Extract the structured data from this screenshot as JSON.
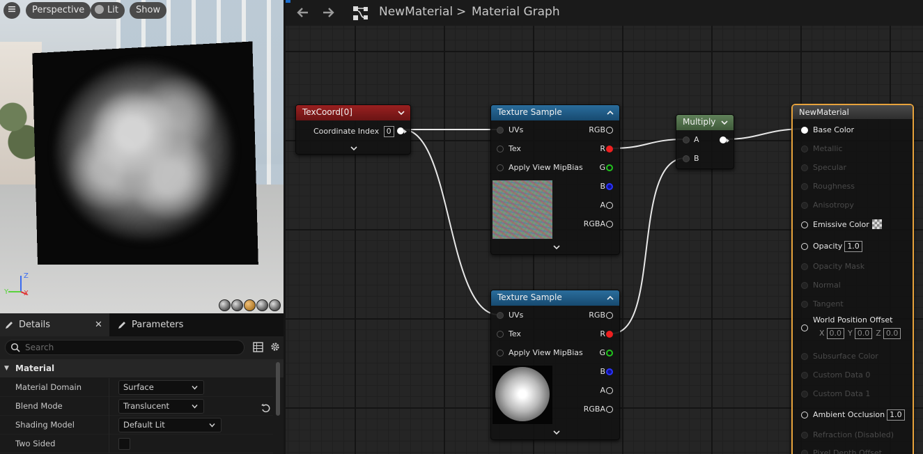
{
  "viewport": {
    "menu_icon": "hamburger-icon",
    "perspective_label": "Perspective",
    "lit_label": "Lit",
    "show_label": "Show",
    "axis": {
      "x": "X",
      "y": "Y",
      "z": "Z"
    }
  },
  "details": {
    "tabs": [
      {
        "label": "Details"
      },
      {
        "label": "Parameters"
      }
    ],
    "close_glyph": "✕",
    "search_placeholder": "Search",
    "category": "Material",
    "rows": [
      {
        "label": "Material Domain",
        "value": "Surface"
      },
      {
        "label": "Blend Mode",
        "value": "Translucent"
      },
      {
        "label": "Shading Model",
        "value": "Default Lit"
      },
      {
        "label": "Two Sided",
        "value": false
      }
    ]
  },
  "graph": {
    "breadcrumb": {
      "asset": "NewMaterial",
      "separator": ">",
      "graph": "Material Graph"
    },
    "texcoord": {
      "title": "TexCoord[0]",
      "pin_label": "Coordinate Index",
      "index_value": "0"
    },
    "texture_sample_1": {
      "title": "Texture Sample",
      "inputs": [
        "UVs",
        "Tex",
        "Apply View MipBias"
      ],
      "outputs": [
        "RGB",
        "R",
        "G",
        "B",
        "A",
        "RGBA"
      ]
    },
    "texture_sample_2": {
      "title": "Texture Sample",
      "inputs": [
        "UVs",
        "Tex",
        "Apply View MipBias"
      ],
      "outputs": [
        "RGB",
        "R",
        "G",
        "B",
        "A",
        "RGBA"
      ]
    },
    "multiply": {
      "title": "Multiply",
      "inputs": [
        "A",
        "B"
      ]
    },
    "result": {
      "title": "NewMaterial",
      "pins": [
        {
          "label": "Base Color",
          "active": true
        },
        {
          "label": "Metallic",
          "active": false
        },
        {
          "label": "Specular",
          "active": false
        },
        {
          "label": "Roughness",
          "active": false
        },
        {
          "label": "Anisotropy",
          "active": false
        },
        {
          "label": "Emissive Color",
          "active": true
        },
        {
          "label": "Opacity",
          "active": true,
          "value": "1.0"
        },
        {
          "label": "Opacity Mask",
          "active": false
        },
        {
          "label": "Normal",
          "active": false
        },
        {
          "label": "Tangent",
          "active": false
        },
        {
          "label": "World Position Offset",
          "active": true
        },
        {
          "label": "Subsurface Color",
          "active": false
        },
        {
          "label": "Custom Data 0",
          "active": false
        },
        {
          "label": "Custom Data 1",
          "active": false
        },
        {
          "label": "Ambient Occlusion",
          "active": true,
          "value": "1.0"
        },
        {
          "label": "Refraction (Disabled)",
          "active": false
        },
        {
          "label": "Pixel Depth Offset",
          "active": false
        }
      ],
      "wpo": {
        "x_label": "X",
        "x": "0.0",
        "y_label": "Y",
        "y": "0.0",
        "z_label": "Z",
        "z": "0.0"
      }
    }
  },
  "colors": {
    "texcoord_header": "#8a1a1a",
    "texture_header": "#1c5a86",
    "multiply_header": "#4f6e48",
    "result_header": "#3a3a3a",
    "result_border": "#e8a33c",
    "wire": "#e8e8e8"
  }
}
